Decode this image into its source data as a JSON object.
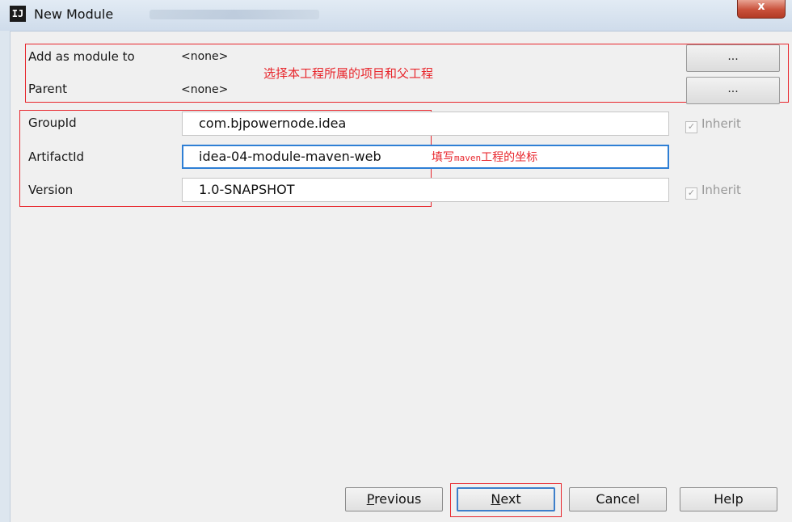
{
  "window": {
    "title": "New Module",
    "icon_text": "IJ",
    "close_label": "x"
  },
  "form": {
    "add_as_module_label": "Add as module to",
    "add_as_module_value": "<none>",
    "parent_label": "Parent",
    "parent_value": "<none>",
    "browse_label": "...",
    "groupid_label": "GroupId",
    "groupid_value": "com.bjpowernode.idea",
    "artifactid_label": "ArtifactId",
    "artifactid_value": "idea-04-module-maven-web",
    "version_label": "Version",
    "version_value": "1.0-SNAPSHOT",
    "inherit_label": "Inherit",
    "check_glyph": "✓"
  },
  "annotations": {
    "project_parent_note": "选择本工程所属的项目和父工程",
    "coords_note_prefix": "填写",
    "coords_note_code": "maven",
    "coords_note_suffix": "工程的坐标"
  },
  "buttons": {
    "previous_mnemonic": "P",
    "previous_rest": "revious",
    "next_mnemonic": "N",
    "next_rest": "ext",
    "cancel": "Cancel",
    "help": "Help"
  },
  "colors": {
    "annotation_red": "#e8262c",
    "focus_blue": "#2e7fd5"
  }
}
